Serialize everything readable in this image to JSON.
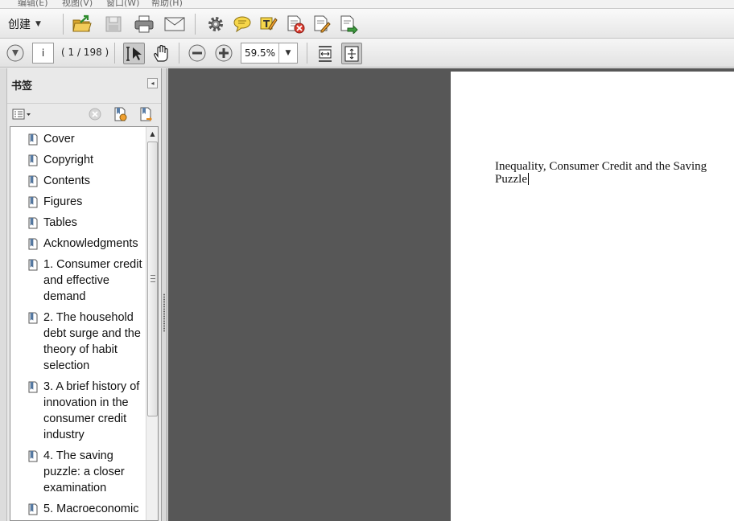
{
  "menubar": {
    "items": [
      "编辑(E)",
      "视图(V)",
      "窗口(W)",
      "帮助(H)"
    ]
  },
  "toolbar": {
    "create_label": "创建",
    "icons": [
      "open-folder",
      "save",
      "print",
      "email",
      "settings",
      "comment",
      "highlight",
      "sign-delete",
      "edit-export",
      "share-export"
    ]
  },
  "navbar": {
    "page_value": "i",
    "page_count": "( 1 / 198 )",
    "zoom": "59.5%"
  },
  "sidebar": {
    "title": "书签",
    "bookmarks": [
      "Cover",
      "Copyright",
      "Contents",
      "Figures",
      "Tables",
      "Acknowledgments",
      "1. Consumer credit and effective demand",
      "2. The household debt surge and the theory of habit selection",
      "3. A brief history of innovation in the consumer credit industry",
      "4. The saving puzzle: a closer examination",
      "5. Macroeconomic"
    ]
  },
  "document": {
    "title_text": "Inequality, Consumer Credit and the Saving Puzzle"
  },
  "colors": {
    "document_background": "#575757",
    "page": "#ffffff",
    "bookmark_icon": "#5b7fa8",
    "delete_red": "#d93a2e",
    "folder_yellow": "#e8b83a"
  }
}
